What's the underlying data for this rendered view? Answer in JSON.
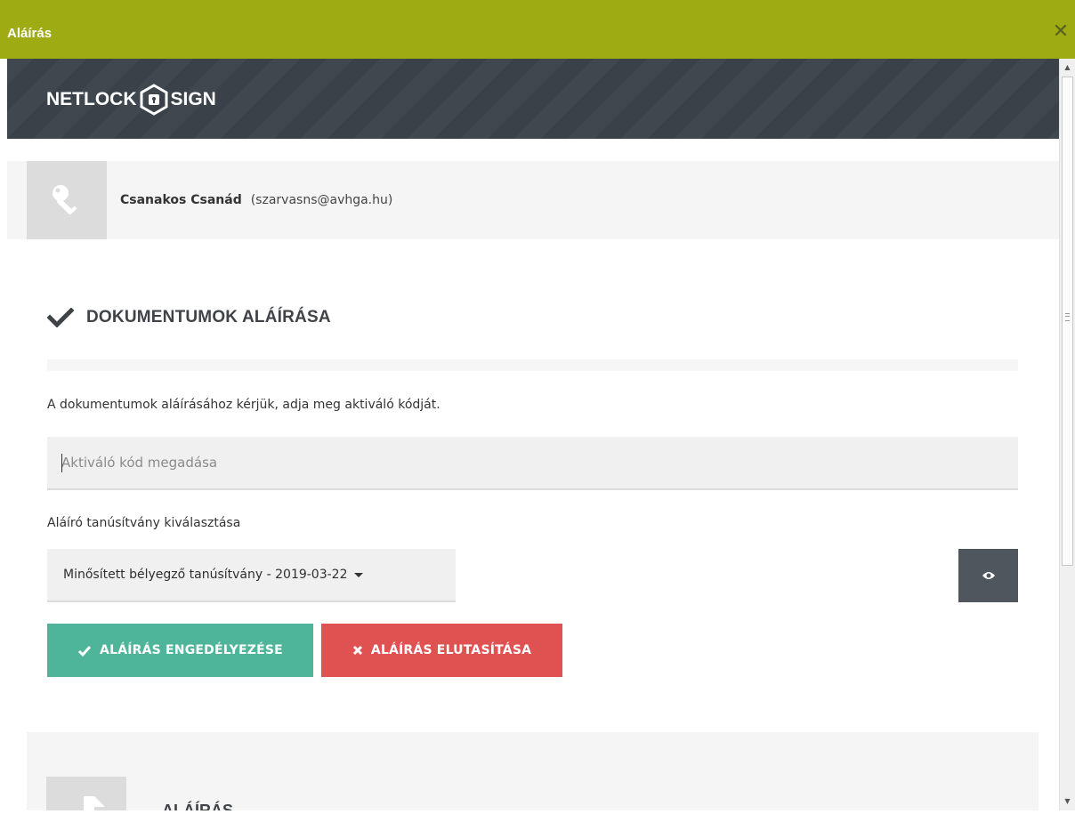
{
  "window": {
    "title": "Aláírás",
    "close_icon": "close-icon",
    "titlebar_color": "#9eab13"
  },
  "banner": {
    "logo_left": "NETLOCK",
    "logo_right": "SIGN",
    "background_color": "#3a4149"
  },
  "signer": {
    "icon": "key-icon",
    "name": "Csanakos Csanád",
    "email": "(szarvasns@avhga.hu)"
  },
  "section": {
    "icon": "checkmark-icon",
    "title": "DOKUMENTUMOK ALÁÍRÁSA",
    "instruction": "A dokumentumok aláírásához kérjük, adja meg aktiváló kódját.",
    "code_input": {
      "value": "",
      "placeholder": "Aktiváló kód megadása"
    },
    "certificate_label": "Aláíró tanúsítvány kiválasztása",
    "certificate_selected": "Minősített bélyegző tanúsítvány - 2019-03-22",
    "view_button_icon": "eye-icon",
    "approve_label": "ALÁÍRÁS ENGEDÉLYEZÉSE",
    "reject_label": "ALÁÍRÁS ELUTASÍTÁSA",
    "approve_color": "#4fb59a",
    "reject_color": "#e05151"
  },
  "bottom_section": {
    "heading": "ALÁÍRÁS ..."
  }
}
